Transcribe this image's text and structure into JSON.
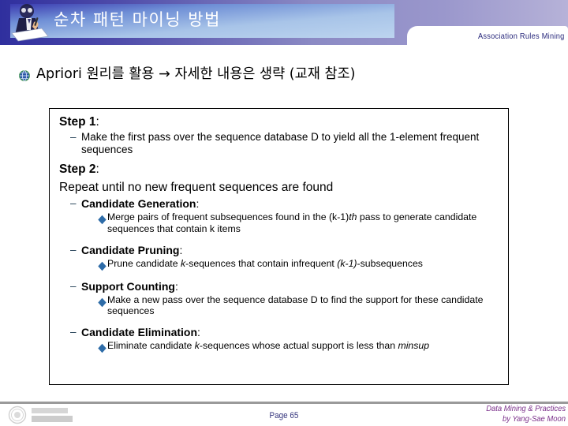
{
  "header": {
    "title": "순차 패턴 마이닝 방법",
    "tab_label": "Association Rules Mining",
    "icon": "person-writing-icon",
    "band_color_left": "#2f2f9e",
    "band_color_right": "#b6b2d8",
    "title_box_color": "#a8c4e8",
    "tab_text_color": "#26267a"
  },
  "main_bullet": {
    "bullet_icon": "globe-icon",
    "text": "Apriori 원리를 활용 → 자세한 내용은 생략 (교재 참조)"
  },
  "content": {
    "step1": {
      "label": "Step 1",
      "colon": ":",
      "items": [
        {
          "mark": "–",
          "text": "Make the first pass over the sequence database D to yield all the 1-element frequent sequences"
        }
      ]
    },
    "step2": {
      "label": "Step 2",
      "colon": ":",
      "repeat_line": "Repeat until no new frequent sequences are found",
      "sections": [
        {
          "mark": "–",
          "heading": "Candidate Generation",
          "colon": ":",
          "bullets": [
            {
              "icon": "diamond-bullet-icon",
              "parts": [
                {
                  "t": "Merge pairs of frequent subsequences found in the (k-1)",
                  "style": "normal"
                },
                {
                  "t": "th",
                  "style": "italic"
                },
                {
                  "t": " pass to generate candidate sequences that contain k items",
                  "style": "normal"
                }
              ]
            }
          ]
        },
        {
          "mark": "–",
          "heading": "Candidate Pruning",
          "colon": ":",
          "bullets": [
            {
              "icon": "diamond-bullet-icon",
              "parts": [
                {
                  "t": "Prune candidate ",
                  "style": "normal"
                },
                {
                  "t": "k",
                  "style": "italic"
                },
                {
                  "t": "-sequences that contain infrequent ",
                  "style": "normal"
                },
                {
                  "t": "(k-1)",
                  "style": "italic"
                },
                {
                  "t": "-subsequences",
                  "style": "normal"
                }
              ]
            }
          ]
        },
        {
          "mark": "–",
          "heading": "Support Counting",
          "colon": ":",
          "bullets": [
            {
              "icon": "diamond-bullet-icon",
              "parts": [
                {
                  "t": "Make a new pass over the sequence database D to find the support for these candidate sequences",
                  "style": "normal"
                }
              ]
            }
          ]
        },
        {
          "mark": "–",
          "heading": "Candidate Elimination",
          "colon": ":",
          "bullets": [
            {
              "icon": "diamond-bullet-icon",
              "parts": [
                {
                  "t": "Eliminate candidate ",
                  "style": "normal"
                },
                {
                  "t": "k",
                  "style": "italic"
                },
                {
                  "t": "-sequences whose actual support is less than ",
                  "style": "normal"
                },
                {
                  "t": "minsup",
                  "style": "italic"
                }
              ]
            }
          ]
        }
      ]
    }
  },
  "footer": {
    "page_label": "Page 65",
    "credit_line1": "Data Mining & Practices",
    "credit_line2": "by Yang-Sae Moon",
    "credit_color": "#7a2f8a",
    "page_color": "#33337c",
    "logo": "university-logo"
  }
}
